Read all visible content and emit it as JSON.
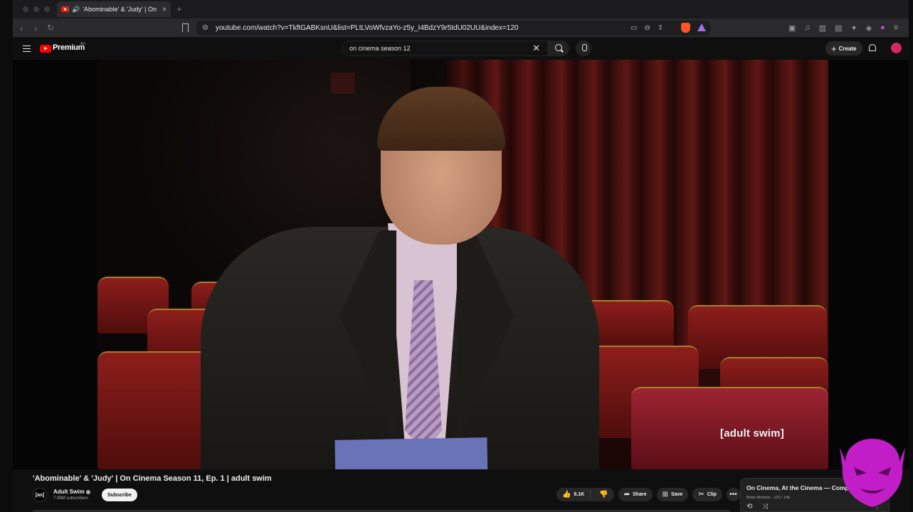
{
  "browser": {
    "tab_title": "'Abominable' & 'Judy' | On",
    "tab_close": "×",
    "new_tab": "+",
    "url": "youtube.com/watch?v=TkftGABKsnU&list=PLtLVoWfvzaYo-z5y_I4BdzY9r5tdU02UU&index=120"
  },
  "youtube": {
    "logo_text": "Premium",
    "region": "AU",
    "search_query": "on cinema season 12",
    "create_label": "Create"
  },
  "video": {
    "watermark": "[adult swim]",
    "title": "'Abominable' & 'Judy' | On Cinema Season 11, Ep. 1 | adult swim",
    "channel_initials": "[as]",
    "channel_name": "Adult Swim",
    "subscribers": "7.98M subscribers",
    "subscribe_label": "Subscribe",
    "likes": "6.1K",
    "share_label": "Share",
    "save_label": "Save",
    "clip_label": "Clip"
  },
  "playlist": {
    "title": "On Cinema, At the Cinema — Comple...",
    "meta": "Brian McInnis · 120 / 146"
  },
  "colors": {
    "brand_red": "#ff0000",
    "overlay_purple": "#c21ec8"
  },
  "icons": [
    "back-icon",
    "forward-icon",
    "reload-icon",
    "bookmark-icon",
    "site-info-icon",
    "cast-icon",
    "zoom-icon",
    "share-icon",
    "brave-shield-icon",
    "brave-rewards-icon",
    "menu-icon",
    "youtube-logo-icon",
    "clear-search-icon",
    "search-icon",
    "mic-icon",
    "plus-icon",
    "bell-icon",
    "like-icon",
    "dislike-icon",
    "share-arrow-icon",
    "save-icon",
    "clip-icon",
    "more-icon",
    "close-icon",
    "loop-icon",
    "shuffle-icon"
  ]
}
